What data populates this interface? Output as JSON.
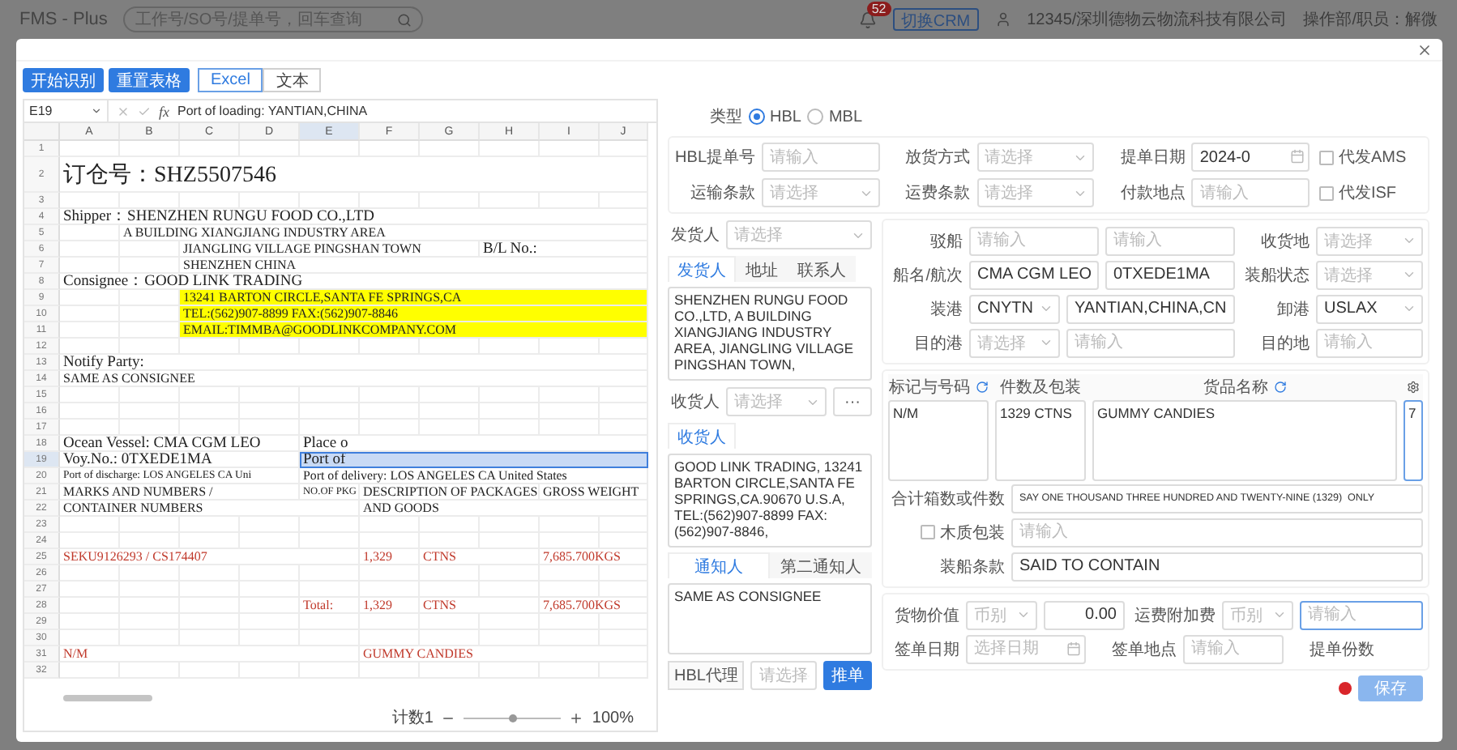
{
  "app_bar": {
    "title": "FMS - Plus",
    "search_placeholder": "工作号/SO号/提单号，回车查询",
    "badge": "52",
    "crm": "切换CRM",
    "company": "12345/深圳德物云物流科技有限公司",
    "user": "操作部/职员：解微"
  },
  "toolbar": {
    "actions": [
      "开始识别",
      "重置表格"
    ],
    "modes": [
      {
        "label": "Excel",
        "selected": true
      },
      {
        "label": "文本",
        "selected": false
      }
    ]
  },
  "sheet": {
    "cell_ref": "E19",
    "function_label": "fx",
    "formula": "Port of loading:  YANTIAN,CHINA",
    "columns": [
      "A",
      "B",
      "C",
      "D",
      "E",
      "F",
      "G",
      "H",
      "I",
      "J"
    ],
    "rows": [
      {
        "number": "1",
        "marked": false
      },
      {
        "number": "2",
        "marked": false,
        "cells": [
          {
            "kind": "title",
            "selected": false,
            "text": "订仓号：SHZ5507546"
          }
        ]
      },
      {
        "number": "3",
        "marked": false
      },
      {
        "number": "4",
        "marked": false,
        "cells": [
          {
            "kind": "label",
            "selected": false,
            "text": "Shipper：SHENZHEN RUNGU FOOD CO.,LTD"
          }
        ]
      },
      {
        "number": "5",
        "marked": false,
        "cells": [
          {},
          {
            "kind": "text",
            "selected": false,
            "text": "A BUILDING XIANGJIANG INDUSTRY AREA"
          }
        ]
      },
      {
        "number": "6",
        "marked": false,
        "cells": [
          {},
          {},
          {
            "kind": "text",
            "selected": false,
            "text": "JIANGLING VILLAGE PINGSHAN TOWN"
          },
          {},
          {},
          {},
          {},
          {
            "kind": "label",
            "selected": false,
            "text": "B/L No.:"
          }
        ]
      },
      {
        "number": "7",
        "marked": false,
        "cells": [
          {},
          {},
          {
            "kind": "text",
            "selected": false,
            "text": "SHENZHEN CHINA"
          }
        ]
      },
      {
        "number": "8",
        "marked": false,
        "cells": [
          {
            "kind": "label",
            "selected": false,
            "text": "Consignee：GOOD LINK TRADING"
          }
        ]
      },
      {
        "number": "9",
        "marked": true,
        "cells": [
          {},
          {},
          {
            "kind": "text",
            "selected": false,
            "text": "13241 BARTON CIRCLE,SANTA FE SPRINGS,CA"
          }
        ]
      },
      {
        "number": "10",
        "marked": true,
        "cells": [
          {},
          {},
          {
            "kind": "text",
            "selected": false,
            "text": "TEL:(562)907-8899   FAX:(562)907-8846"
          }
        ]
      },
      {
        "number": "11",
        "marked": true,
        "cells": [
          {},
          {},
          {
            "kind": "text",
            "selected": false,
            "text": "EMAIL:TIMMBA@GOODLINKCOMPANY.COM"
          }
        ]
      },
      {
        "number": "12",
        "marked": false
      },
      {
        "number": "13",
        "marked": false,
        "cells": [
          {
            "kind": "label",
            "selected": false,
            "text": "Notify Party:"
          }
        ]
      },
      {
        "number": "14",
        "marked": false,
        "cells": [
          {
            "kind": "text",
            "selected": false,
            "text": "SAME AS CONSIGNEE"
          }
        ]
      },
      {
        "number": "15",
        "marked": false
      },
      {
        "number": "16",
        "marked": false
      },
      {
        "number": "17",
        "marked": false
      },
      {
        "number": "18",
        "marked": false,
        "cells": [
          {
            "kind": "label",
            "selected": false,
            "text": "Ocean Vessel: CMA CGM LEO"
          },
          {},
          {},
          {},
          {
            "kind": "label",
            "selected": false,
            "text": "Place o"
          }
        ]
      },
      {
        "number": "19",
        "marked": false,
        "cells": [
          {
            "kind": "label",
            "selected": false,
            "text": "Voy.No.: 0TXEDE1MA"
          },
          {},
          {},
          {},
          {
            "kind": "label",
            "selected": true,
            "text": "Port of"
          }
        ]
      },
      {
        "number": "20",
        "marked": false,
        "cells": [
          {
            "kind": "text",
            "selected": false,
            "text": "Port of discharge: LOS ANGELES CA Uni"
          },
          {},
          {},
          {},
          {
            "kind": "label",
            "selected": false,
            "text": "Port of delivery: LOS ANGELES CA United States"
          }
        ]
      },
      {
        "number": "21",
        "marked": false,
        "cells": [
          {
            "kind": "text",
            "selected": false,
            "text": "MARKS AND NUMBERS /"
          },
          {},
          {},
          {},
          {
            "kind": "text",
            "selected": false,
            "text": "NO.OF PKG"
          },
          {
            "kind": "text",
            "selected": false,
            "text": "DESCRIPTION OF PACKAGES"
          },
          {},
          {},
          {
            "kind": "text",
            "selected": false,
            "text": "GROSS WEIGHT"
          }
        ]
      },
      {
        "number": "22",
        "marked": false,
        "cells": [
          {
            "kind": "text",
            "selected": false,
            "text": "CONTAINER NUMBERS"
          },
          {},
          {},
          {},
          {},
          {
            "kind": "text",
            "selected": false,
            "text": "AND GOODS"
          }
        ]
      },
      {
        "number": "23",
        "marked": false
      },
      {
        "number": "24",
        "marked": false
      },
      {
        "number": "25",
        "marked": false,
        "cells": [
          {
            "kind": "text",
            "selected": false,
            "color": "#c0392b",
            "text": "SEKU9126293 / CS174407"
          },
          {},
          {},
          {},
          {},
          {
            "kind": "text",
            "selected": false,
            "color": "#c0392b",
            "text": "1,329"
          },
          {
            "kind": "text",
            "selected": false,
            "color": "#c0392b",
            "text": "CTNS"
          },
          {},
          {
            "kind": "text",
            "selected": false,
            "color": "#c0392b",
            "text": "7,685.700KGS"
          }
        ]
      },
      {
        "number": "26",
        "marked": false
      },
      {
        "number": "27",
        "marked": false
      },
      {
        "number": "28",
        "marked": false,
        "cells": [
          {},
          {},
          {},
          {},
          {
            "kind": "text",
            "selected": false,
            "color": "#c0392b",
            "text": "Total:"
          },
          {
            "kind": "text",
            "selected": false,
            "color": "#c0392b",
            "text": "1,329"
          },
          {
            "kind": "text",
            "selected": false,
            "color": "#c0392b",
            "text": "CTNS"
          },
          {},
          {
            "kind": "text",
            "selected": false,
            "color": "#c0392b",
            "text": "7,685.700KGS"
          }
        ]
      },
      {
        "number": "29",
        "marked": false
      },
      {
        "number": "30",
        "marked": false
      },
      {
        "number": "31",
        "marked": false,
        "cells": [
          {
            "kind": "text",
            "selected": false,
            "color": "#c0392b",
            "text": "N/M"
          },
          {},
          {},
          {},
          {},
          {
            "kind": "text",
            "selected": false,
            "color": "#c0392b",
            "text": "GUMMY CANDIES"
          }
        ]
      },
      {
        "number": "32",
        "marked": false
      }
    ],
    "status": {
      "count": "计数1",
      "level": 0.5,
      "reading": "100%"
    }
  },
  "form": {
    "type": {
      "label": "类型",
      "options": [
        {
          "label": "HBL",
          "selected": true
        },
        {
          "label": "MBL",
          "selected": false
        }
      ]
    },
    "top_rows": [
      [
        {
          "label": "HBL提单号",
          "kind": "input",
          "placeholder": "请输入"
        },
        {
          "label": "放货方式",
          "kind": "select",
          "placeholder": "请选择"
        },
        {
          "label": "提单日期",
          "kind": "date",
          "value": "2024-0"
        },
        {
          "label": "代发AMS",
          "kind": "checkbox",
          "checked": false
        }
      ],
      [
        {
          "label": "运输条款",
          "kind": "select",
          "placeholder": "请选择"
        },
        {
          "label": "运费条款",
          "kind": "select",
          "placeholder": "请选择"
        },
        {
          "label": "付款地点",
          "kind": "input",
          "placeholder": "请输入"
        },
        {
          "label": "代发ISF",
          "kind": "checkbox",
          "checked": false
        }
      ]
    ],
    "parties": [
      {
        "select": {
          "label": "发货人",
          "placeholder": "请选择"
        },
        "tabs": [
          {
            "label": "发货人",
            "selected": true
          },
          {
            "label": "地址",
            "selected": false
          },
          {
            "label": "联系人",
            "selected": false
          }
        ],
        "text": "SHENZHEN RUNGU FOOD CO.,LTD, A BUILDING XIANGJIANG INDUSTRY AREA, JIANGLING VILLAGE PINGSHAN TOWN,"
      },
      {
        "select": {
          "label": "收货人",
          "placeholder": "请选择",
          "more": "···"
        },
        "tabs": [
          {
            "label": "收货人",
            "selected": true
          }
        ],
        "text": "GOOD LINK TRADING, 13241 BARTON CIRCLE,SANTA FE SPRINGS,CA.90670 U.S.A, TEL:(562)907-8899  FAX:(562)907-8846,"
      },
      {
        "tabs": [
          {
            "label": "通知人",
            "selected": true
          },
          {
            "label": "第二通知人",
            "selected": false
          }
        ],
        "text": "SAME AS CONSIGNEE"
      }
    ],
    "agent": {
      "label": "HBL代理",
      "placeholder": "请选择",
      "button": "推单"
    },
    "ports": [
      {
        "label": "驳船",
        "fields": [
          {
            "kind": "input",
            "placeholder": "请输入"
          },
          {
            "kind": "input",
            "placeholder": "请输入"
          }
        ],
        "side": {
          "label": "收货地",
          "kind": "select",
          "placeholder": "请选择"
        }
      },
      {
        "label": "船名/航次",
        "fields": [
          {
            "kind": "input",
            "value": "CMA CGM LEO"
          },
          {
            "kind": "input",
            "value": "0TXEDE1MA"
          }
        ],
        "side": {
          "label": "装船状态",
          "kind": "select",
          "placeholder": "请选择"
        }
      },
      {
        "label": "装港",
        "fields": [
          {
            "kind": "select",
            "value": "CNYTN"
          },
          {
            "kind": "input",
            "value": "YANTIAN,CHINA,CN"
          }
        ],
        "side": {
          "label": "卸港",
          "kind": "select",
          "value": "USLAX"
        }
      },
      {
        "label": "目的港",
        "fields": [
          {
            "kind": "select",
            "placeholder": "请选择"
          },
          {
            "kind": "input",
            "placeholder": "请输入"
          }
        ],
        "side": {
          "label": "目的地",
          "kind": "input",
          "placeholder": "请输入"
        }
      }
    ],
    "cargo": [
      {
        "label": "标记与号码",
        "refresh": true,
        "text": "N/M",
        "focused": false
      },
      {
        "label": "件数及包装",
        "refresh": false,
        "text": "1329 CTNS",
        "focused": false
      },
      {
        "label": "货品名称",
        "refresh": true,
        "text": "GUMMY CANDIES",
        "focused": false
      },
      {
        "refresh": true,
        "text": "7",
        "focused": true
      }
    ],
    "summary": [
      {
        "label": "合计箱数或件数",
        "field": {
          "kind": "input",
          "value": "SAY ONE THOUSAND THREE HUNDRED AND TWENTY-NINE (1329)  ONLY"
        }
      },
      {
        "label": "木质包装",
        "checked": false,
        "field": {
          "kind": "input",
          "placeholder": "请输入"
        }
      },
      {
        "label": "装船条款",
        "field": {
          "kind": "input",
          "value": "SAID TO CONTAIN"
        }
      }
    ],
    "charges": [
      [
        {
          "label": "货物价值",
          "fields": [
            {
              "kind": "select",
              "placeholder": "币别"
            },
            {
              "kind": "number",
              "value": "0.00"
            }
          ]
        },
        {
          "label": "运费附加费",
          "fields": [
            {
              "kind": "select",
              "placeholder": "币别"
            },
            {
              "kind": "input",
              "placeholder": "请输入",
              "focused": true
            }
          ]
        }
      ],
      [
        {
          "label": "签单日期",
          "fields": [
            {
              "kind": "date",
              "placeholder": "选择日期"
            }
          ]
        },
        {
          "label": "签单地点",
          "fields": [
            {
              "kind": "input",
              "placeholder": "请输入",
              "focused": false
            }
          ]
        },
        {
          "label": "提单份数"
        }
      ]
    ],
    "save": {
      "label": "保存",
      "alert": true
    }
  }
}
